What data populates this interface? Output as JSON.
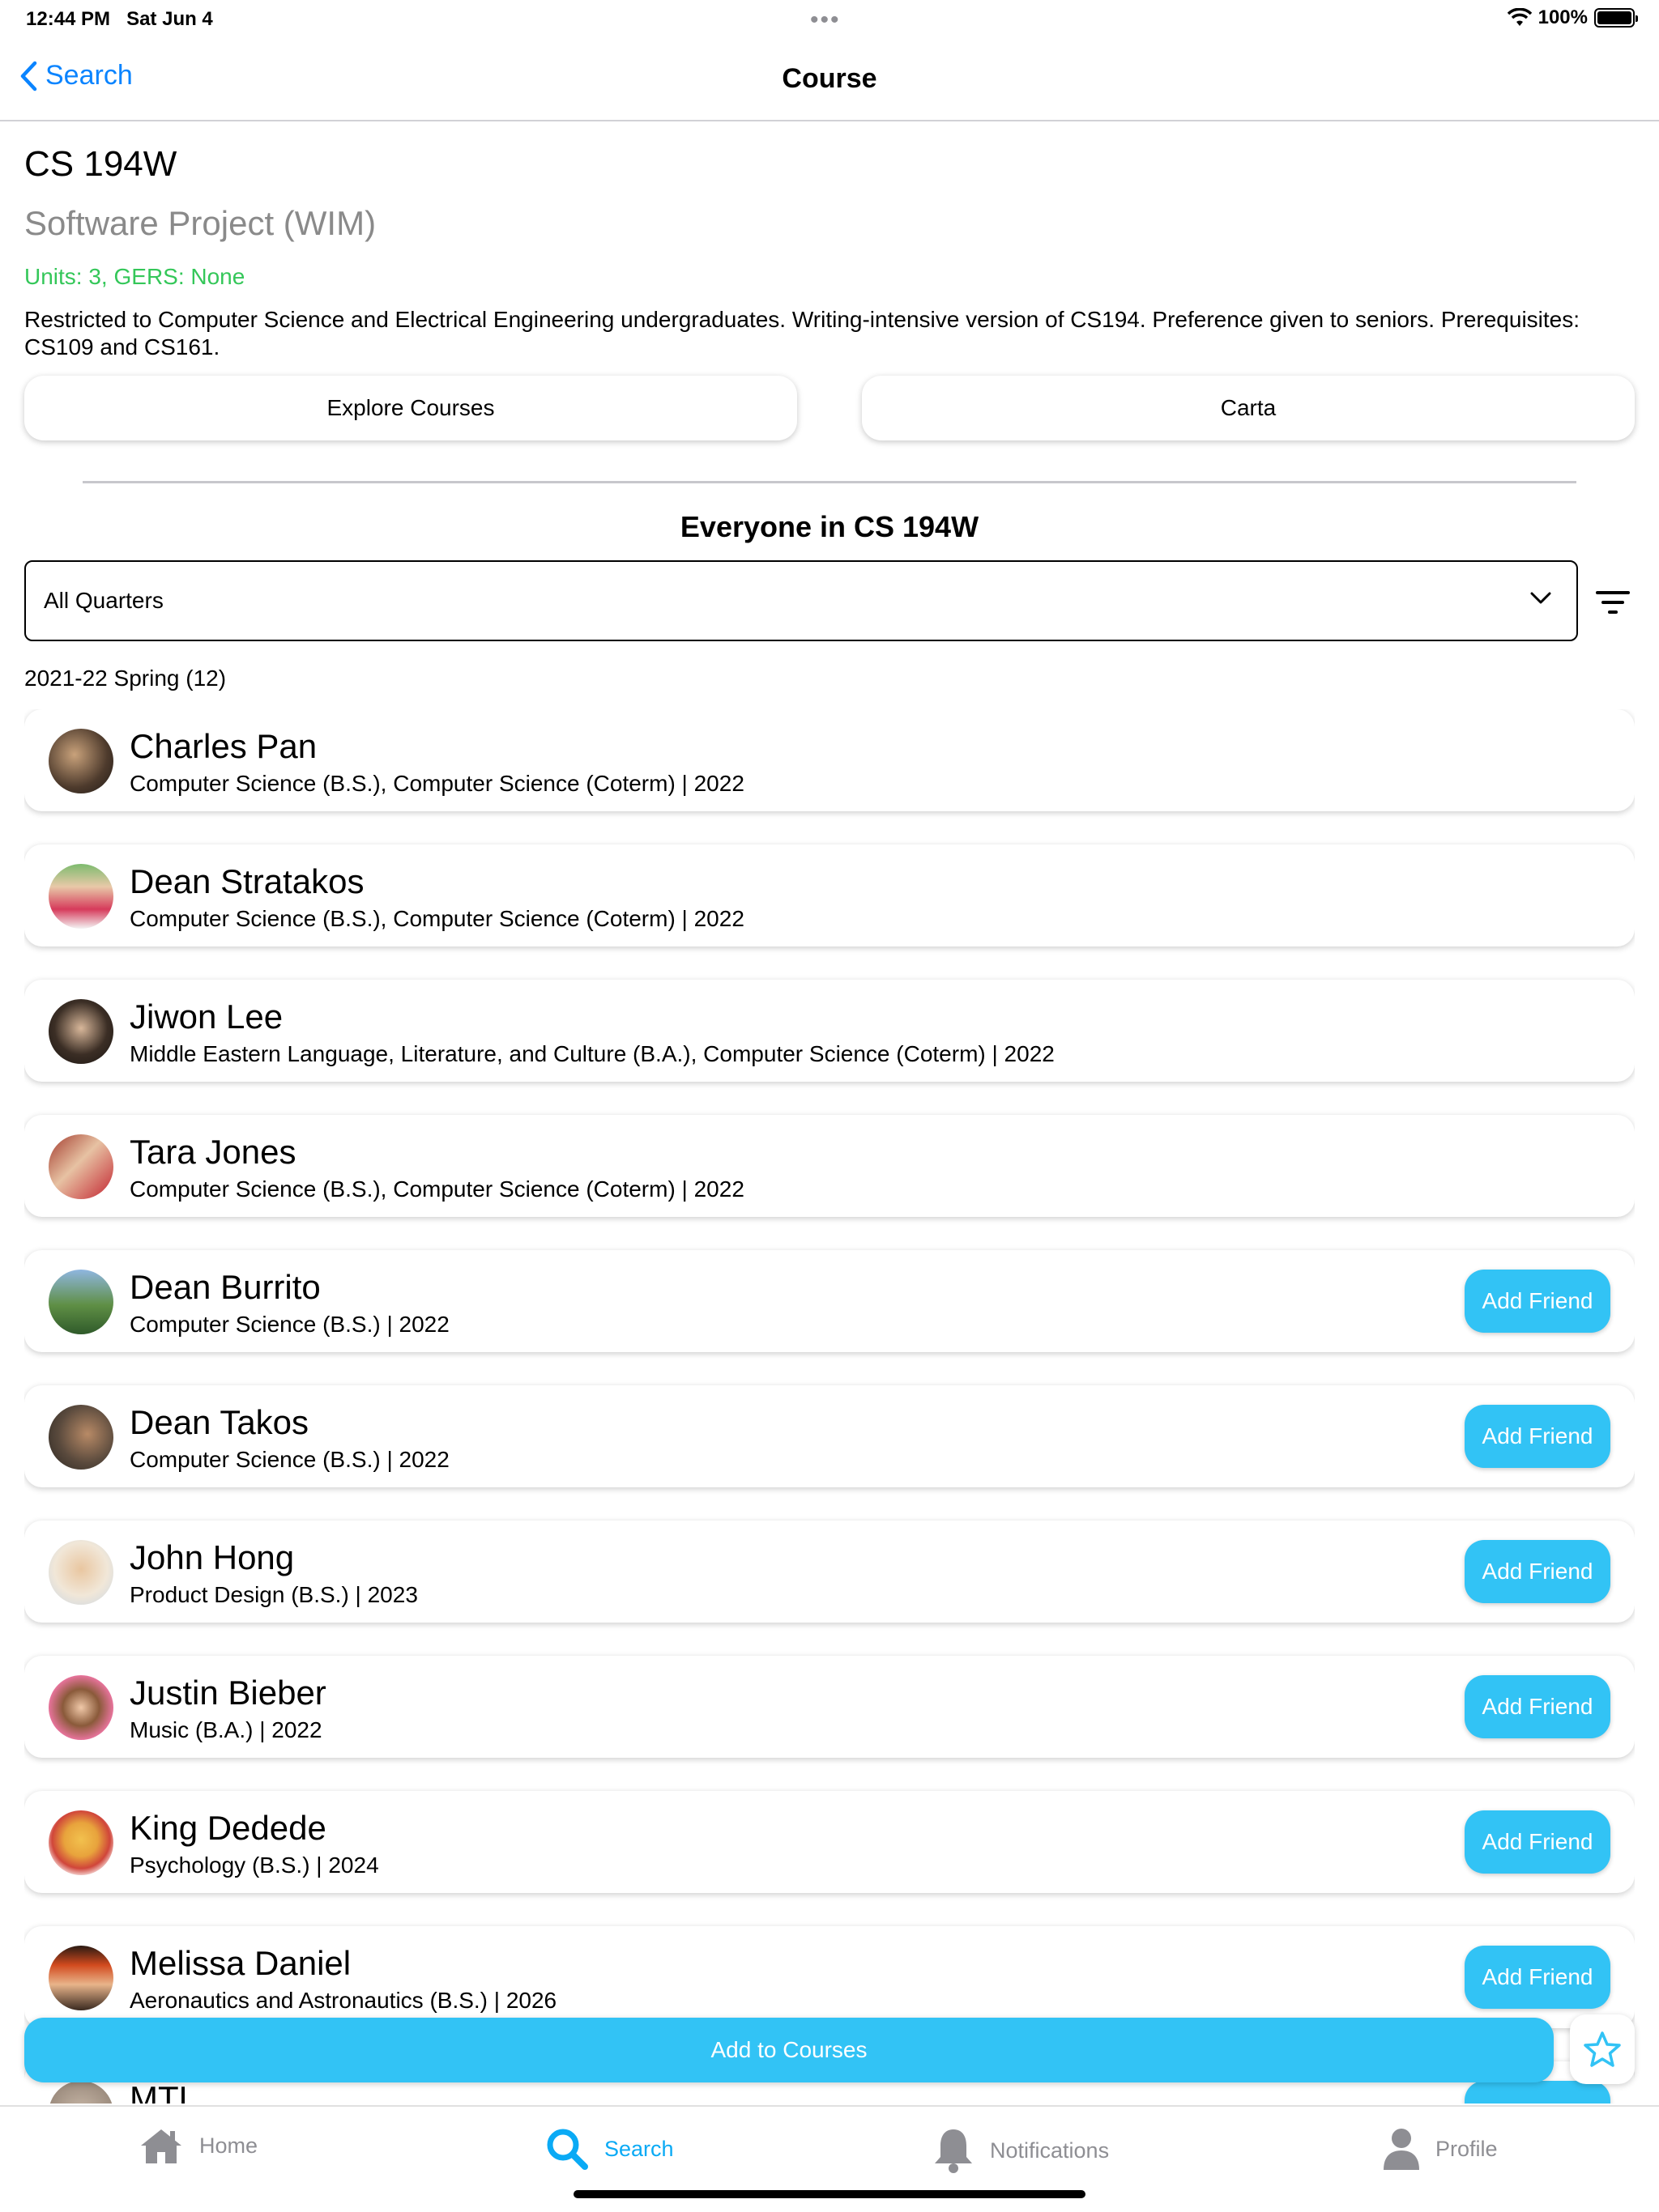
{
  "status_bar": {
    "time": "12:44 PM",
    "date": "Sat Jun 4",
    "battery": "100%",
    "icons": [
      "wifi-icon",
      "battery-icon"
    ]
  },
  "nav": {
    "back_label": "Search",
    "title": "Course"
  },
  "course": {
    "code": "CS 194W",
    "title": "Software Project (WIM)",
    "units": "Units: 3, GERS: None",
    "description": "Restricted to Computer Science and Electrical Engineering undergraduates.  Writing-intensive version of CS194. Preference given to seniors. Prerequisites: CS109 and CS161."
  },
  "links": {
    "explore": "Explore Courses",
    "carta": "Carta"
  },
  "section": {
    "title": "Everyone in CS 194W"
  },
  "quarter_select": {
    "value": "All Quarters"
  },
  "group": {
    "label": "2021-22 Spring (12)"
  },
  "students": [
    {
      "name": "Charles Pan",
      "info": "Computer Science (B.S.), Computer Science (Coterm) | 2022",
      "action": ""
    },
    {
      "name": "Dean Stratakos",
      "info": "Computer Science (B.S.), Computer Science (Coterm) | 2022",
      "action": ""
    },
    {
      "name": "Jiwon Lee",
      "info": "Middle Eastern Language, Literature, and Culture (B.A.), Computer Science (Coterm) | 2022",
      "action": ""
    },
    {
      "name": "Tara Jones",
      "info": "Computer Science (B.S.), Computer Science (Coterm) | 2022",
      "action": ""
    },
    {
      "name": "Dean Burrito",
      "info": "Computer Science (B.S.) | 2022",
      "action": "Add Friend"
    },
    {
      "name": "Dean Takos",
      "info": "Computer Science (B.S.) | 2022",
      "action": "Add Friend"
    },
    {
      "name": "John Hong",
      "info": "Product Design (B.S.) | 2023",
      "action": "Add Friend"
    },
    {
      "name": "Justin Bieber",
      "info": "Music (B.A.) | 2022",
      "action": "Add Friend"
    },
    {
      "name": "King Dedede",
      "info": "Psychology (B.S.) | 2024",
      "action": "Add Friend"
    },
    {
      "name": "Melissa Daniel",
      "info": "Aeronautics and Astronautics (B.S.) | 2026",
      "action": "Add Friend"
    },
    {
      "name": "MTL",
      "info": "",
      "action": "Add Friend"
    }
  ],
  "bottom": {
    "add_courses": "Add to Courses"
  },
  "tabs": [
    {
      "label": "Home",
      "icon": "home-icon"
    },
    {
      "label": "Search",
      "icon": "search-icon"
    },
    {
      "label": "Notifications",
      "icon": "bell-icon"
    },
    {
      "label": "Profile",
      "icon": "person-icon"
    }
  ],
  "colors": {
    "accent": "#32c3f5",
    "link": "#0a84ff",
    "units_green": "#34c759"
  }
}
